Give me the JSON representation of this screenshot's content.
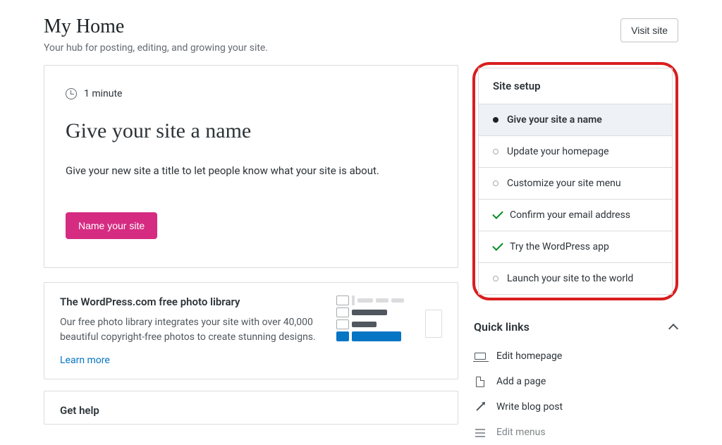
{
  "header": {
    "title": "My Home",
    "subtitle": "Your hub for posting, editing, and growing your site.",
    "visit_button": "Visit site"
  },
  "task": {
    "duration": "1 minute",
    "title": "Give your site a name",
    "description": "Give your new site a title to let people know what your site is about.",
    "button": "Name your site"
  },
  "setup": {
    "heading": "Site setup",
    "items": [
      {
        "label": "Give your site a name",
        "status": "active"
      },
      {
        "label": "Update your homepage",
        "status": "pending"
      },
      {
        "label": "Customize your site menu",
        "status": "pending"
      },
      {
        "label": "Confirm your email address",
        "status": "done"
      },
      {
        "label": "Try the WordPress app",
        "status": "done"
      },
      {
        "label": "Launch your site to the world",
        "status": "pending"
      }
    ]
  },
  "photo": {
    "title": "The WordPress.com free photo library",
    "description": "Our free photo library integrates your site with over 40,000 beautiful copyright-free photos to create stunning designs.",
    "link": "Learn more"
  },
  "help": {
    "title": "Get help"
  },
  "quicklinks": {
    "heading": "Quick links",
    "items": [
      {
        "label": "Edit homepage",
        "icon": "laptop"
      },
      {
        "label": "Add a page",
        "icon": "page"
      },
      {
        "label": "Write blog post",
        "icon": "pen"
      },
      {
        "label": "Edit menus",
        "icon": "list"
      }
    ]
  }
}
